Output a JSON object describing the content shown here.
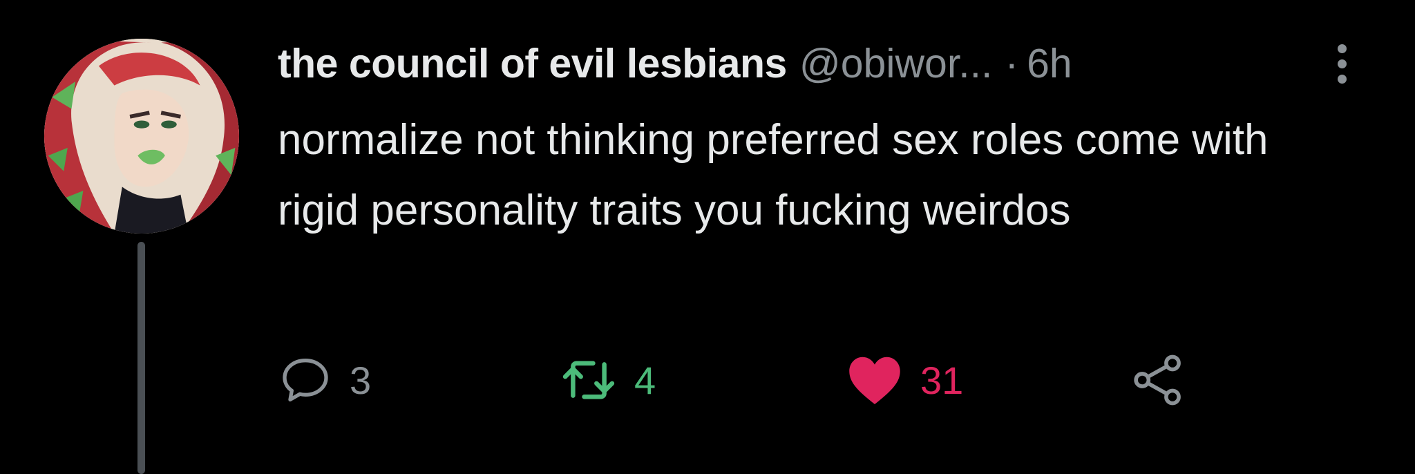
{
  "tweet": {
    "display_name": "the council of evil lesbians",
    "handle": "@obiwor...",
    "separator": "·",
    "time": "6h",
    "text": "normalize not thinking preferred sex roles come with rigid personality traits you fucking weirdos"
  },
  "actions": {
    "reply": {
      "icon": "speech-bubble-icon",
      "count": "3"
    },
    "retweet": {
      "icon": "retweet-icon",
      "count": "4",
      "color": "#4cbb7a"
    },
    "like": {
      "icon": "heart-icon",
      "count": "31",
      "color": "#e0245e"
    },
    "share": {
      "icon": "share-icon"
    }
  },
  "colors": {
    "background": "#000000",
    "primary_text": "#e7e9ea",
    "secondary_text": "#8b9196",
    "thread_line": "#4a4f54"
  }
}
